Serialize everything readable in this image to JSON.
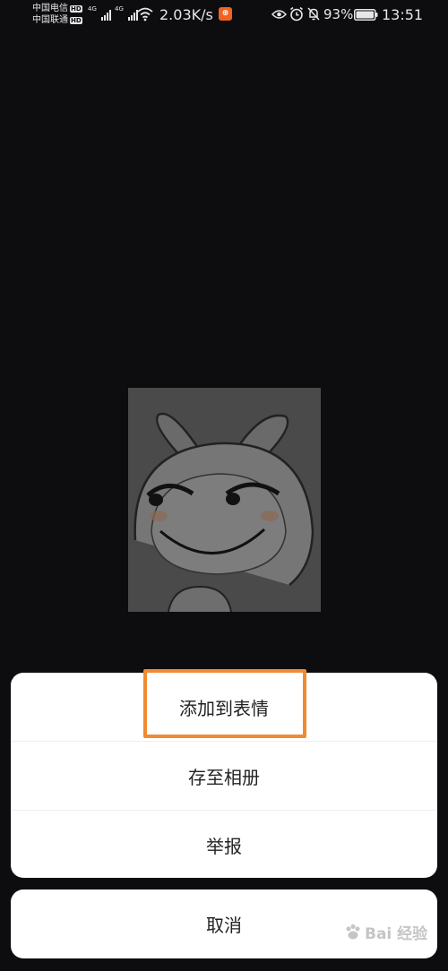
{
  "status_bar": {
    "carrier_1": "中国电信",
    "carrier_2": "中国联通",
    "hd": "HD",
    "network_type": "4G",
    "net_speed": "2.03K/s",
    "battery": "93%",
    "time": "13:51"
  },
  "image": {
    "icon": "sticker-image"
  },
  "action_sheet": {
    "items": [
      {
        "label": "添加到表情"
      },
      {
        "label": "存至相册"
      },
      {
        "label": "举报"
      }
    ],
    "cancel_label": "取消"
  },
  "highlight_color": "#f08a33",
  "watermark": "Bai 经验"
}
